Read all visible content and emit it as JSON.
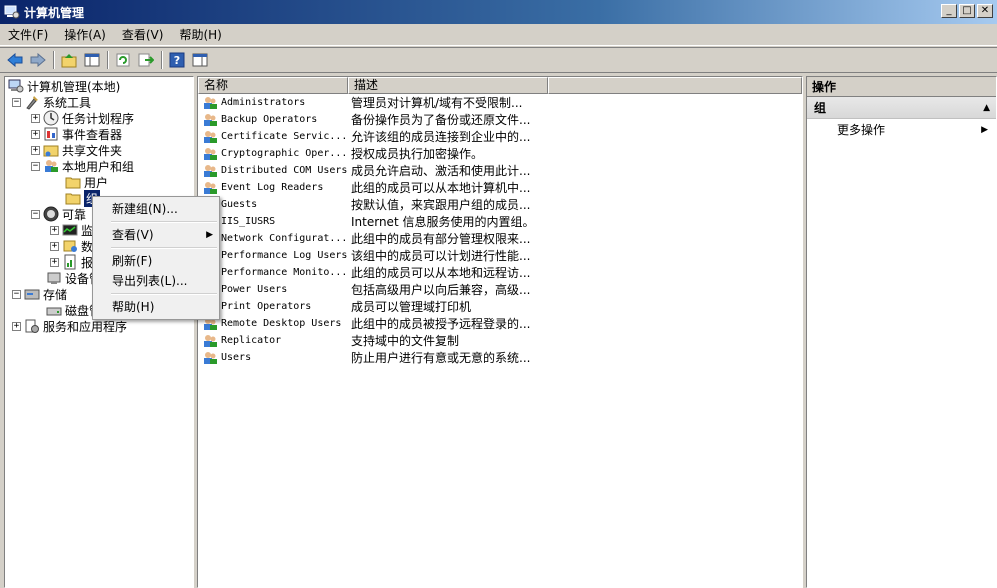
{
  "window": {
    "title": "计算机管理",
    "controls": [
      "_",
      "□",
      "✕"
    ]
  },
  "menubar": [
    "文件(F)",
    "操作(A)",
    "查看(V)",
    "帮助(H)"
  ],
  "tree": [
    {
      "label": "计算机管理(本地)",
      "icon": "computer-management-icon",
      "expander": ""
    },
    {
      "label": "系统工具",
      "icon": "tools-icon",
      "expander": "−"
    },
    {
      "label": "任务计划程序",
      "icon": "clock-icon",
      "expander": "+"
    },
    {
      "label": "事件查看器",
      "icon": "event-viewer-icon",
      "expander": "+"
    },
    {
      "label": "共享文件夹",
      "icon": "shared-folder-icon",
      "expander": "+"
    },
    {
      "label": "本地用户和组",
      "icon": "users-icon",
      "expander": "−"
    },
    {
      "label": "用户",
      "icon": "folder-icon",
      "expander": ""
    },
    {
      "label": "组",
      "icon": "folder-icon",
      "expander": ""
    },
    {
      "label": "可靠",
      "icon": "gauge-icon",
      "expander": "−"
    },
    {
      "label": "监",
      "icon": "monitor-icon",
      "expander": "+"
    },
    {
      "label": "数",
      "icon": "data-icon",
      "expander": "+"
    },
    {
      "label": "报",
      "icon": "report-icon",
      "expander": "+"
    },
    {
      "label": "设备管",
      "icon": "device-manager-icon",
      "expander": ""
    },
    {
      "label": "存储",
      "icon": "storage-icon",
      "expander": "−"
    },
    {
      "label": "磁盘管",
      "icon": "disk-icon",
      "expander": ""
    },
    {
      "label": "服务和应用程序",
      "icon": "services-icon",
      "expander": "+"
    }
  ],
  "list": {
    "columns": [
      "名称",
      "描述"
    ],
    "rows": [
      {
        "name": "Administrators",
        "desc": "管理员对计算机/域有不受限制..."
      },
      {
        "name": "Backup Operators",
        "desc": "备份操作员为了备份或还原文件..."
      },
      {
        "name": "Certificate Servic...",
        "desc": "允许该组的成员连接到企业中的..."
      },
      {
        "name": "Cryptographic Oper...",
        "desc": "授权成员执行加密操作。"
      },
      {
        "name": "Distributed COM Users",
        "desc": "成员允许启动、激活和使用此计..."
      },
      {
        "name": "Event Log Readers",
        "desc": "此组的成员可以从本地计算机中..."
      },
      {
        "name": "Guests",
        "desc": "按默认值，来宾跟用户组的成员..."
      },
      {
        "name": "IIS_IUSRS",
        "desc": "Internet 信息服务使用的内置组。"
      },
      {
        "name": "Network Configurat...",
        "desc": "此组中的成员有部分管理权限来..."
      },
      {
        "name": "Performance Log Users",
        "desc": "该组中的成员可以计划进行性能..."
      },
      {
        "name": "Performance Monito...",
        "desc": "此组的成员可以从本地和远程访..."
      },
      {
        "name": "Power Users",
        "desc": "包括高级用户以向后兼容，高级..."
      },
      {
        "name": "Print Operators",
        "desc": "成员可以管理域打印机"
      },
      {
        "name": "Remote Desktop Users",
        "desc": "此组中的成员被授予远程登录的..."
      },
      {
        "name": "Replicator",
        "desc": "支持域中的文件复制"
      },
      {
        "name": "Users",
        "desc": "防止用户进行有意或无意的系统..."
      }
    ]
  },
  "actions": {
    "header": "操作",
    "group": "组",
    "items": [
      "更多操作"
    ]
  },
  "context_menu": [
    "新建组(N)...",
    "查看(V)",
    "刷新(F)",
    "导出列表(L)...",
    "帮助(H)"
  ]
}
